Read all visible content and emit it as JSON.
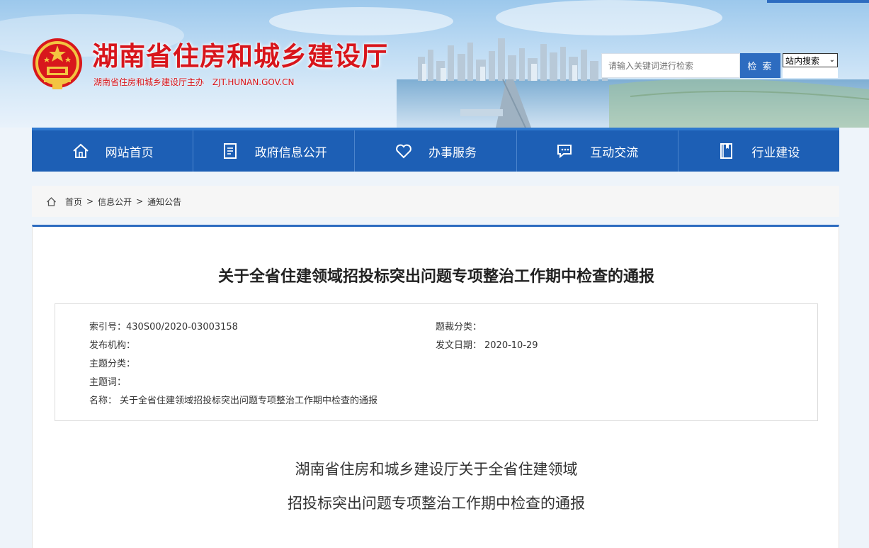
{
  "header": {
    "site_title": "湖南省住房和城乡建设厅",
    "site_subtitle": "湖南省住房和城乡建设厅主办",
    "site_domain": "ZJT.HUNAN.GOV.CN",
    "title_color": "#d8151b"
  },
  "search": {
    "placeholder": "请输入关键词进行检索",
    "button_label": "检 索",
    "scope_selected": "站内搜索"
  },
  "nav": {
    "items": [
      {
        "label": "网站首页",
        "icon": "home-icon"
      },
      {
        "label": "政府信息公开",
        "icon": "document-icon"
      },
      {
        "label": "办事服务",
        "icon": "heart-icon"
      },
      {
        "label": "互动交流",
        "icon": "chat-icon"
      },
      {
        "label": "行业建设",
        "icon": "book-icon"
      }
    ],
    "background": "#1d5fb5"
  },
  "breadcrumb": {
    "items": [
      "首页",
      "信息公开",
      "通知公告"
    ],
    "separator": ">"
  },
  "article": {
    "title": "关于全省住建领域招投标突出问题专项整治工作期中检查的通报",
    "meta": {
      "index_label": "索引号：",
      "index_value": "430S00/2020-03003158",
      "category_label": "题裁分类：",
      "category_value": "",
      "publisher_label": "发布机构：",
      "publisher_value": "",
      "date_label": "发文日期：",
      "date_value": "2020-10-29",
      "topic_label": "主题分类：",
      "topic_value": "",
      "keywords_label": "主题词：",
      "keywords_value": "",
      "name_label": "名称：",
      "name_value": "关于全省住建领域招投标突出问题专项整治工作期中检查的通报"
    },
    "body_heading_line1": "湖南省住房和城乡建设厅关于全省住建领域",
    "body_heading_line2": "招投标突出问题专项整治工作期中检查的通报"
  }
}
